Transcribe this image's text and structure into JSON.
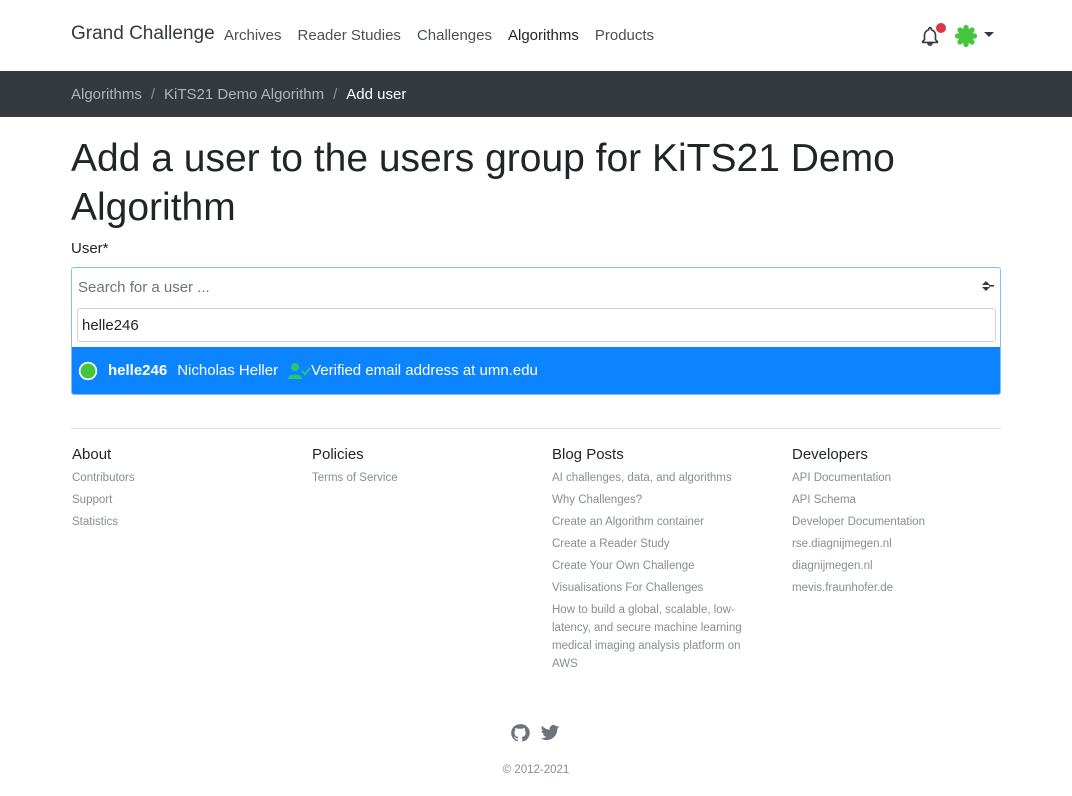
{
  "nav": {
    "brand": "Grand Challenge",
    "links": [
      "Archives",
      "Reader Studies",
      "Challenges",
      "Algorithms",
      "Products"
    ]
  },
  "breadcrumb": {
    "items": [
      "Algorithms",
      "KiTS21 Demo Algorithm"
    ],
    "current": "Add user"
  },
  "page": {
    "title": "Add a user to the users group for KiTS21 Demo Algorithm"
  },
  "form": {
    "label": "User*",
    "placeholder": "Search for a user ...",
    "search_value": "helle246",
    "option": {
      "username": "helle246",
      "full_name": "Nicholas Heller",
      "verified_text": "Verified email address at umn.edu"
    }
  },
  "footer": {
    "about": {
      "heading": "About",
      "links": [
        "Contributors",
        "Support",
        "Statistics"
      ]
    },
    "policies": {
      "heading": "Policies",
      "links": [
        "Terms of Service"
      ]
    },
    "blog": {
      "heading": "Blog Posts",
      "links": [
        "AI challenges, data, and algorithms",
        "Why Challenges?",
        "Create an Algorithm container",
        "Create a Reader Study",
        "Create Your Own Challenge",
        "Visualisations For Challenges",
        "How to build a global, scalable, low-latency, and secure machine learning medical imaging analysis platform on AWS"
      ]
    },
    "developers": {
      "heading": "Developers",
      "links": [
        "API Documentation",
        "API Schema",
        "Developer Documentation",
        "rse.diagnijmegen.nl",
        "diagnijmegen.nl",
        "mevis.fraunhofer.de"
      ]
    },
    "copyright": "© 2012-2021"
  },
  "colors": {
    "navbar_dark": "#343a40",
    "select_highlight": "#0d84ff",
    "notification_dot": "#dc3545",
    "avatar_green": "#44c63d",
    "verified_green": "#28c76f"
  },
  "icons": [
    "bell-icon",
    "avatar-icon",
    "sort-arrows-icon",
    "user-check-icon",
    "github-icon",
    "twitter-icon"
  ]
}
